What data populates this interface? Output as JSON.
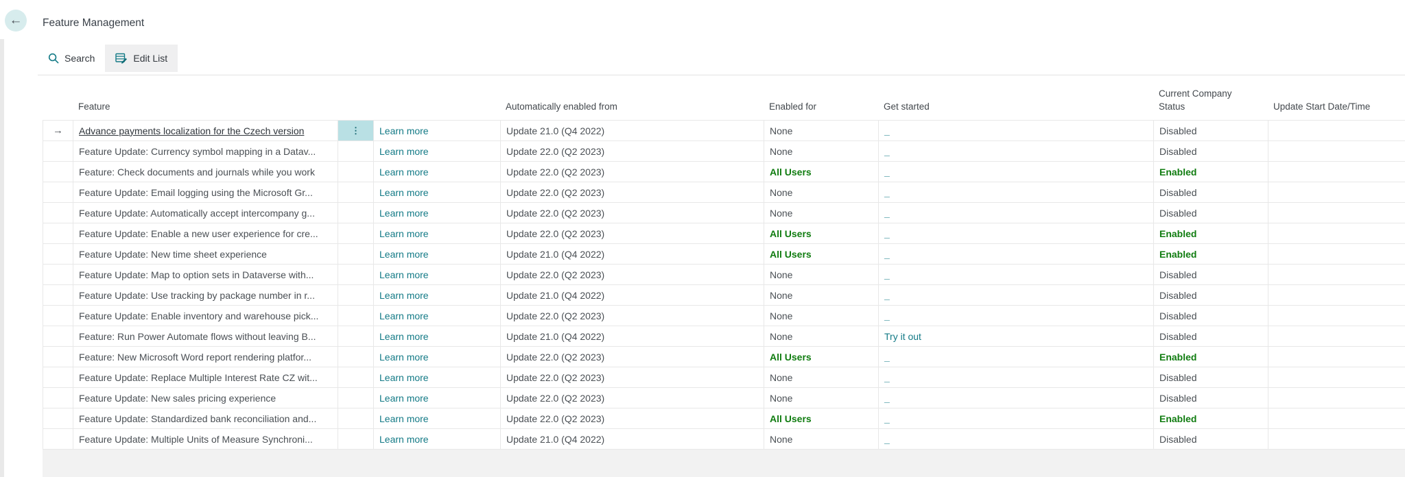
{
  "page": {
    "title": "Feature Management"
  },
  "icons": {
    "back": "←",
    "row_pointer": "→",
    "ellipsis": "⋮",
    "search": "magnifier",
    "edit_list": "table-pencil"
  },
  "colors": {
    "accent_teal": "#137a86",
    "favorable_green": "#107c10",
    "selected_cell_bg": "#b9e0e4",
    "back_circle_bg": "#d7eced"
  },
  "toolbar": {
    "search_label": "Search",
    "edit_list_label": "Edit List"
  },
  "table": {
    "columns": {
      "feature": "Feature",
      "automatically_enabled_from": "Automatically enabled from",
      "enabled_for": "Enabled for",
      "get_started": "Get started",
      "current_company_status": "Current Company Status",
      "update_start_date_time": "Update Start Date/Time"
    },
    "learn_more_label": "Learn more",
    "rows": [
      {
        "feature": "Advance payments localization for the Czech version",
        "automatically_enabled_from": "Update 21.0 (Q4 2022)",
        "enabled_for": "None",
        "get_started": "_",
        "current_company_status": "Disabled",
        "update_start_date_time": "",
        "selected": true
      },
      {
        "feature": "Feature Update: Currency symbol mapping in a Datav...",
        "automatically_enabled_from": "Update 22.0 (Q2 2023)",
        "enabled_for": "None",
        "get_started": "_",
        "current_company_status": "Disabled",
        "update_start_date_time": "",
        "selected": false
      },
      {
        "feature": "Feature: Check documents and journals while you work",
        "automatically_enabled_from": "Update 22.0 (Q2 2023)",
        "enabled_for": "All Users",
        "get_started": "_",
        "current_company_status": "Enabled",
        "update_start_date_time": "",
        "selected": false
      },
      {
        "feature": "Feature Update: Email logging using the Microsoft Gr...",
        "automatically_enabled_from": "Update 22.0 (Q2 2023)",
        "enabled_for": "None",
        "get_started": "_",
        "current_company_status": "Disabled",
        "update_start_date_time": "",
        "selected": false
      },
      {
        "feature": "Feature Update: Automatically accept intercompany g...",
        "automatically_enabled_from": "Update 22.0 (Q2 2023)",
        "enabled_for": "None",
        "get_started": "_",
        "current_company_status": "Disabled",
        "update_start_date_time": "",
        "selected": false
      },
      {
        "feature": "Feature Update: Enable a new user experience for cre...",
        "automatically_enabled_from": "Update 22.0 (Q2 2023)",
        "enabled_for": "All Users",
        "get_started": "_",
        "current_company_status": "Enabled",
        "update_start_date_time": "",
        "selected": false
      },
      {
        "feature": "Feature Update: New time sheet experience",
        "automatically_enabled_from": "Update 21.0 (Q4 2022)",
        "enabled_for": "All Users",
        "get_started": "_",
        "current_company_status": "Enabled",
        "update_start_date_time": "",
        "selected": false
      },
      {
        "feature": "Feature Update: Map to option sets in Dataverse with...",
        "automatically_enabled_from": "Update 22.0 (Q2 2023)",
        "enabled_for": "None",
        "get_started": "_",
        "current_company_status": "Disabled",
        "update_start_date_time": "",
        "selected": false
      },
      {
        "feature": "Feature Update: Use tracking by package number in r...",
        "automatically_enabled_from": "Update 21.0 (Q4 2022)",
        "enabled_for": "None",
        "get_started": "_",
        "current_company_status": "Disabled",
        "update_start_date_time": "",
        "selected": false
      },
      {
        "feature": "Feature Update: Enable inventory and warehouse pick...",
        "automatically_enabled_from": "Update 22.0 (Q2 2023)",
        "enabled_for": "None",
        "get_started": "_",
        "current_company_status": "Disabled",
        "update_start_date_time": "",
        "selected": false
      },
      {
        "feature": "Feature: Run Power Automate flows without leaving B...",
        "automatically_enabled_from": "Update 21.0 (Q4 2022)",
        "enabled_for": "None",
        "get_started": "Try it out",
        "current_company_status": "Disabled",
        "update_start_date_time": "",
        "selected": false
      },
      {
        "feature": "Feature: New Microsoft Word report rendering platfor...",
        "automatically_enabled_from": "Update 22.0 (Q2 2023)",
        "enabled_for": "All Users",
        "get_started": "_",
        "current_company_status": "Enabled",
        "update_start_date_time": "",
        "selected": false
      },
      {
        "feature": "Feature Update: Replace Multiple Interest Rate CZ wit...",
        "automatically_enabled_from": "Update 22.0 (Q2 2023)",
        "enabled_for": "None",
        "get_started": "_",
        "current_company_status": "Disabled",
        "update_start_date_time": "",
        "selected": false
      },
      {
        "feature": "Feature Update: New sales pricing experience",
        "automatically_enabled_from": "Update 22.0 (Q2 2023)",
        "enabled_for": "None",
        "get_started": "_",
        "current_company_status": "Disabled",
        "update_start_date_time": "",
        "selected": false
      },
      {
        "feature": "Feature Update: Standardized bank reconciliation and...",
        "automatically_enabled_from": "Update 22.0 (Q2 2023)",
        "enabled_for": "All Users",
        "get_started": "_",
        "current_company_status": "Enabled",
        "update_start_date_time": "",
        "selected": false
      },
      {
        "feature": "Feature Update: Multiple Units of Measure Synchroni...",
        "automatically_enabled_from": "Update 21.0 (Q4 2022)",
        "enabled_for": "None",
        "get_started": "_",
        "current_company_status": "Disabled",
        "update_start_date_time": "",
        "selected": false
      }
    ]
  }
}
